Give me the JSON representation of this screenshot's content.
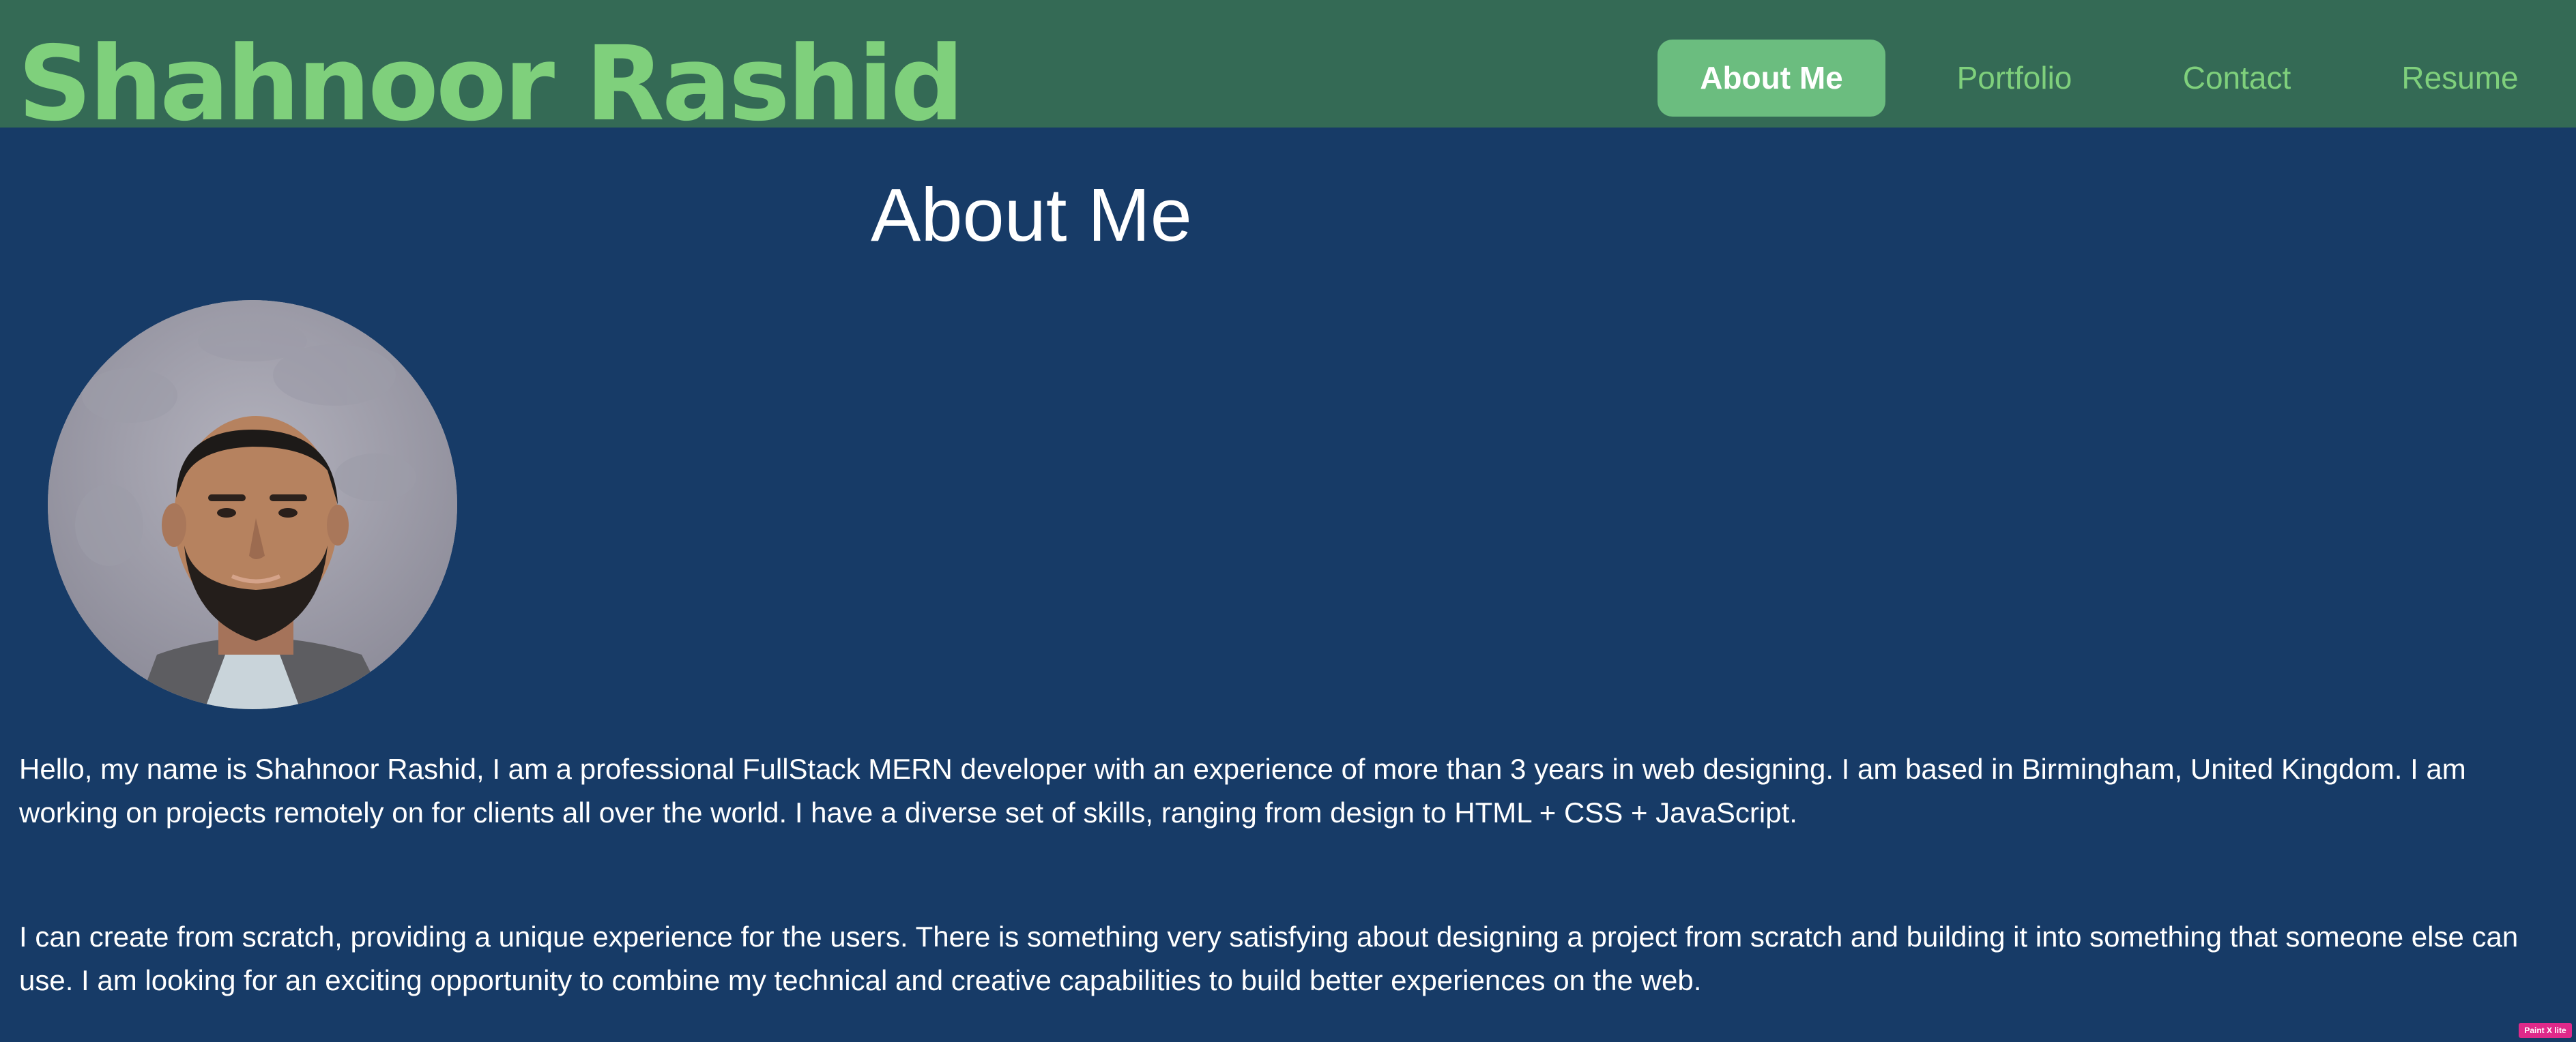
{
  "header": {
    "site_title": "Shahnoor Rashid",
    "nav": [
      {
        "label": "About Me",
        "active": true
      },
      {
        "label": "Portfolio",
        "active": false
      },
      {
        "label": "Contact",
        "active": false
      },
      {
        "label": "Resume",
        "active": false
      }
    ]
  },
  "about": {
    "title": "About Me",
    "photo_alt": "profile-photo",
    "paragraphs": [
      "Hello, my name is Shahnoor Rashid, I am a professional FullStack MERN developer with an experience of more than 3 years in web designing. I am based in Birmingham, United Kingdom. I am working on projects remotely on for clients all over the world. I have a diverse set of skills, ranging from design to HTML + CSS + JavaScript.",
      "I can create from scratch, providing a unique experience for the users. There is something very satisfying about designing a project from scratch and building it into something that someone else can use. I am looking for an exciting opportunity to combine my technical and creative capabilities to build better experiences on the web."
    ]
  },
  "badge": {
    "label": "Paint X lite"
  },
  "colors": {
    "header_bg": "#346a55",
    "page_bg": "#173b67",
    "accent_green": "#7fd07c",
    "active_nav_bg": "#6bbd7f",
    "text": "#ffffff"
  }
}
